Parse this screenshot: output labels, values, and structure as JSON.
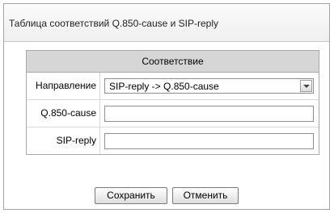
{
  "dialog": {
    "title": "Таблица соответствий Q.850-cause и SIP-reply"
  },
  "form": {
    "header": "Соответствие",
    "direction": {
      "label": "Направление",
      "value": "SIP-reply -> Q.850-cause"
    },
    "q850_cause": {
      "label": "Q.850-cause",
      "value": ""
    },
    "sip_reply": {
      "label": "SIP-reply",
      "value": ""
    }
  },
  "buttons": {
    "save_label": "Сохранить",
    "cancel_label": "Отменить"
  }
}
